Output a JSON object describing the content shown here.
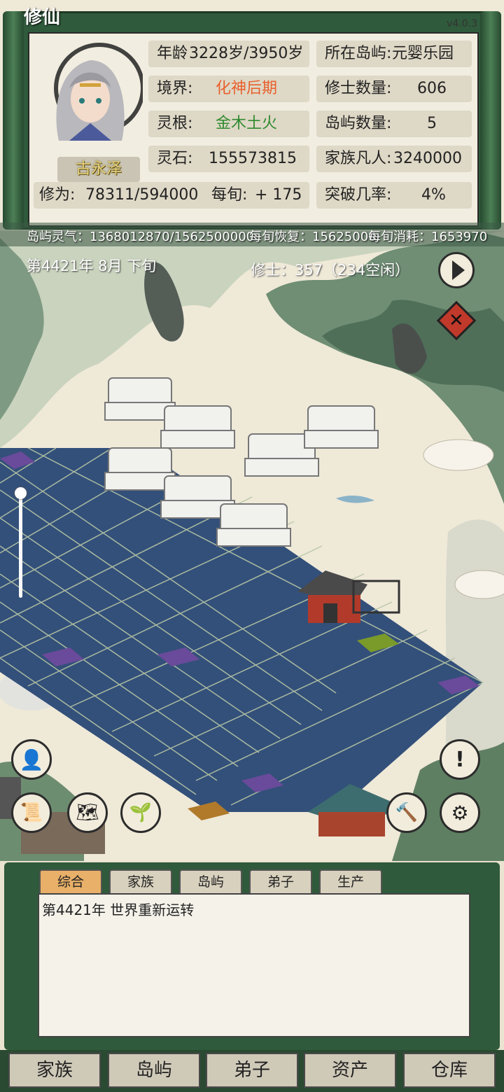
{
  "header": {
    "title_fragment": "修仙",
    "version": "v4.0.3"
  },
  "profile": {
    "name": "古永泽",
    "age_label": "年龄",
    "age_value": "3228岁/3950岁",
    "realm_label": "境界:",
    "realm_value": "化神后期",
    "root_label": "灵根:",
    "root_value": "金木土火",
    "stone_label": "灵石:",
    "stone_value": "155573815",
    "cultivation_label": "修为:",
    "cultivation_value": "78311/594000",
    "per_turn_label": "每旬:",
    "per_turn_value": "+ 175"
  },
  "island_stats": {
    "island_label": "所在岛屿:",
    "island_value": "元婴乐园",
    "cultivator_count_label": "修士数量:",
    "cultivator_count_value": "606",
    "island_count_label": "岛屿数量:",
    "island_count_value": "5",
    "mortals_label": "家族凡人:",
    "mortals_value": "3240000",
    "breakthrough_label": "突破几率:",
    "breakthrough_value": "4%"
  },
  "info_bar": {
    "aura": "岛屿灵气：1368012870/1562500000",
    "recovery": "每旬恢复：15625000",
    "consumption": "每旬消耗：1653970"
  },
  "status": {
    "date": "第4421年 8月 下旬",
    "cultivators": "修士：357（234空闲）"
  },
  "controls": {
    "zoom_level": 1.0
  },
  "log": {
    "tabs": [
      "综合",
      "家族",
      "岛屿",
      "弟子",
      "生产"
    ],
    "active_tab": "综合",
    "entries": [
      "第4421年 世界重新运转"
    ]
  },
  "bottom_nav": {
    "items": [
      "家族",
      "岛屿",
      "弟子",
      "资产",
      "仓库"
    ]
  },
  "colors": {
    "realm": "#e8602c",
    "root": "#2f8a2f",
    "name": "#e8d27a",
    "frame_green": "#2f5a3b",
    "active_tab": "#e8b068"
  }
}
